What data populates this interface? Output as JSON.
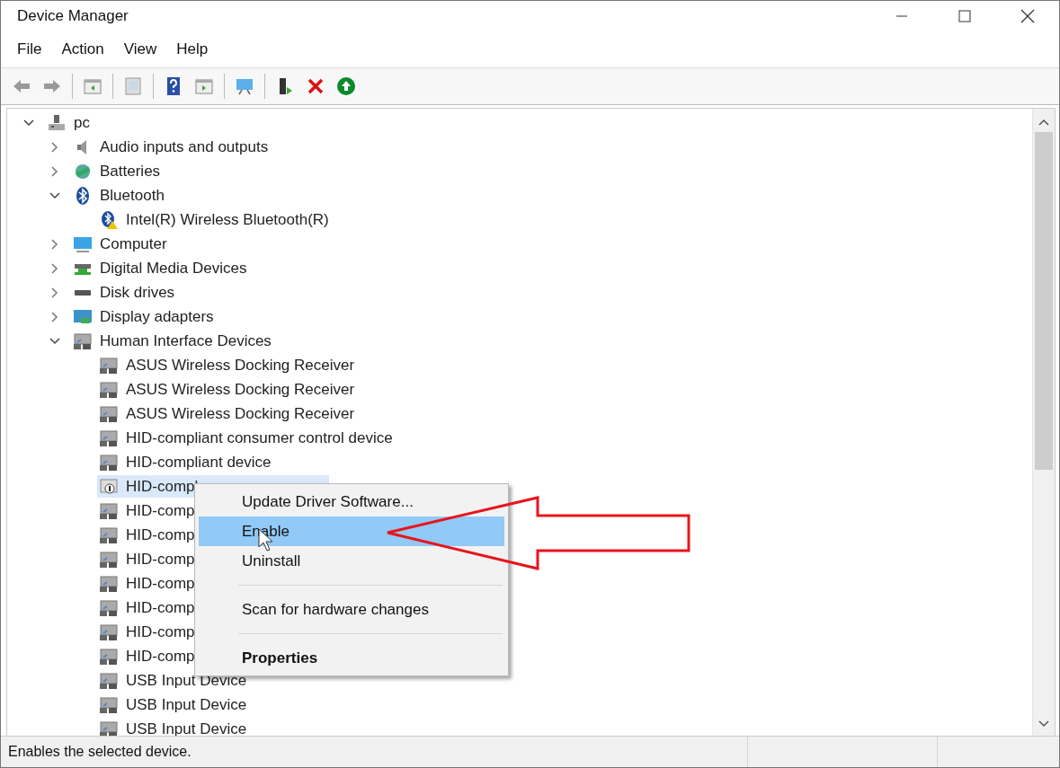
{
  "window": {
    "title": "Device Manager"
  },
  "menu_bar": [
    "File",
    "Action",
    "View",
    "Help"
  ],
  "toolbar": [
    {
      "kind": "back"
    },
    {
      "kind": "forward"
    },
    {
      "kind": "sep"
    },
    {
      "kind": "panel"
    },
    {
      "kind": "sep"
    },
    {
      "kind": "props"
    },
    {
      "kind": "sep"
    },
    {
      "kind": "help"
    },
    {
      "kind": "run"
    },
    {
      "kind": "sep"
    },
    {
      "kind": "monitor"
    },
    {
      "kind": "sep"
    },
    {
      "kind": "driver"
    },
    {
      "kind": "remove"
    },
    {
      "kind": "enable"
    }
  ],
  "tree": [
    {
      "label": "pc",
      "kind": "root",
      "expanded": true,
      "selected": false,
      "children": [
        {
          "label": "Audio inputs and outputs",
          "kind": "audio",
          "expanded": false,
          "selected": false
        },
        {
          "label": "Batteries",
          "kind": "battery",
          "expanded": false,
          "selected": false
        },
        {
          "label": "Bluetooth",
          "kind": "bluetooth",
          "expanded": true,
          "selected": false,
          "children": [
            {
              "label": "Intel(R) Wireless Bluetooth(R)",
              "kind": "bt-warning",
              "selected": false
            }
          ]
        },
        {
          "label": "Computer",
          "kind": "computer",
          "expanded": false,
          "selected": false
        },
        {
          "label": "Digital Media Devices",
          "kind": "media",
          "expanded": false,
          "selected": false
        },
        {
          "label": "Disk drives",
          "kind": "disk",
          "expanded": false,
          "selected": false
        },
        {
          "label": "Display adapters",
          "kind": "display",
          "expanded": false,
          "selected": false
        },
        {
          "label": "Human Interface Devices",
          "kind": "hid",
          "expanded": true,
          "selected": false,
          "children": [
            {
              "label": "ASUS Wireless Docking Receiver",
              "kind": "hid",
              "selected": false
            },
            {
              "label": "ASUS Wireless Docking Receiver",
              "kind": "hid",
              "selected": false
            },
            {
              "label": "ASUS Wireless Docking Receiver",
              "kind": "hid",
              "selected": false
            },
            {
              "label": "HID-compliant consumer control device",
              "kind": "hid",
              "selected": false
            },
            {
              "label": "HID-compliant device",
              "kind": "hid",
              "selected": false
            },
            {
              "label": "HID-compl",
              "kind": "hid-disabled",
              "selected": true
            },
            {
              "label": "HID-comp",
              "kind": "hid",
              "selected": false
            },
            {
              "label": "HID-comp",
              "kind": "hid",
              "selected": false
            },
            {
              "label": "HID-comp",
              "kind": "hid",
              "selected": false
            },
            {
              "label": "HID-comp",
              "kind": "hid",
              "selected": false
            },
            {
              "label": "HID-comp",
              "kind": "hid",
              "selected": false
            },
            {
              "label": "HID-comp",
              "kind": "hid",
              "selected": false
            },
            {
              "label": "HID-comp",
              "kind": "hid",
              "selected": false
            },
            {
              "label": "USB Input Device",
              "kind": "hid",
              "selected": false
            },
            {
              "label": "USB Input Device",
              "kind": "hid",
              "selected": false
            },
            {
              "label": "USB Input Device",
              "kind": "hid",
              "selected": false
            }
          ]
        }
      ]
    }
  ],
  "context_menu": [
    {
      "kind": "item",
      "label": "Update Driver Software...",
      "selected": false,
      "default": false
    },
    {
      "kind": "item",
      "label": "Enable",
      "selected": true,
      "default": false
    },
    {
      "kind": "item",
      "label": "Uninstall",
      "selected": false,
      "default": false
    },
    {
      "kind": "separator"
    },
    {
      "kind": "item",
      "label": "Scan for hardware changes",
      "selected": false,
      "default": false
    },
    {
      "kind": "separator"
    },
    {
      "kind": "item",
      "label": "Properties",
      "selected": false,
      "default": true
    }
  ],
  "status_bar": {
    "text": "Enables the selected device."
  }
}
